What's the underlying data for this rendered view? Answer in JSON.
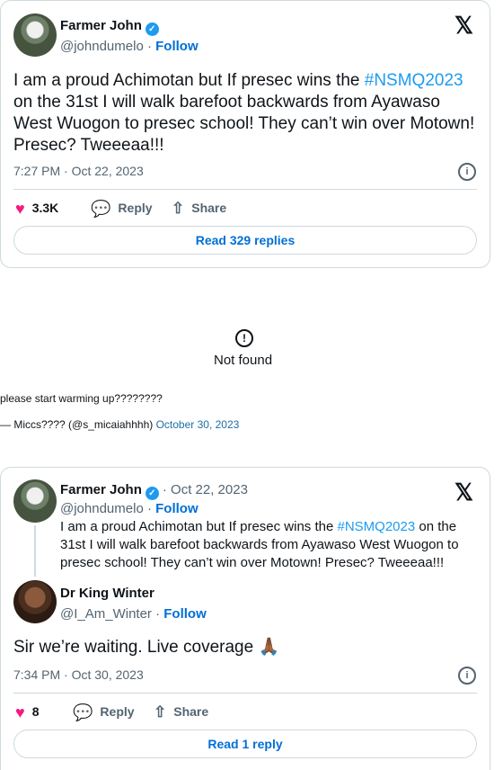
{
  "tweet1": {
    "name": "Farmer John",
    "handle": "@johndumelo",
    "follow": "Follow",
    "text_before": "I am a proud Achimotan but If presec wins the ",
    "hashtag": "#NSMQ2023",
    "text_after": " on the 31st I will walk barefoot backwards from Ayawaso West Wuogon to presec school! They can’t win over Motown! Presec? Tweeeaa!!!",
    "timestamp": "7:27 PM · Oct 22, 2023",
    "likes": "3.3K",
    "reply": "Reply",
    "share": "Share",
    "read_replies": "Read 329 replies"
  },
  "embed": {
    "not_found": "Not found",
    "quote_text": "please start warming up????????",
    "attribution": "— Miccs???? (@s_micaiahhhh)",
    "date": "October 30, 2023"
  },
  "tweet2": {
    "parent_name": "Farmer John",
    "parent_date": "· Oct 22, 2023",
    "parent_handle": "@johndumelo",
    "follow": "Follow",
    "parent_before": "I am a proud Achimotan but If presec wins the ",
    "parent_hashtag": "#NSMQ2023",
    "parent_after": " on the 31st I will walk barefoot backwards from Ayawaso West Wuogon to presec school! They can’t win over Motown! Presec? Tweeeaa!!!",
    "name": "Dr King Winter",
    "handle": "@I_Am_Winter",
    "text": "Sir we’re waiting. Live coverage 🙏🏾",
    "timestamp": "7:34 PM · Oct 30, 2023",
    "likes": "8",
    "reply": "Reply",
    "share": "Share",
    "read_replies": "Read 1 reply"
  },
  "icons": {
    "verified": "✓",
    "x_logo": "𝕏",
    "info": "i",
    "heart": "♥",
    "reply": "💬",
    "share": "⇧",
    "alert": "!"
  }
}
